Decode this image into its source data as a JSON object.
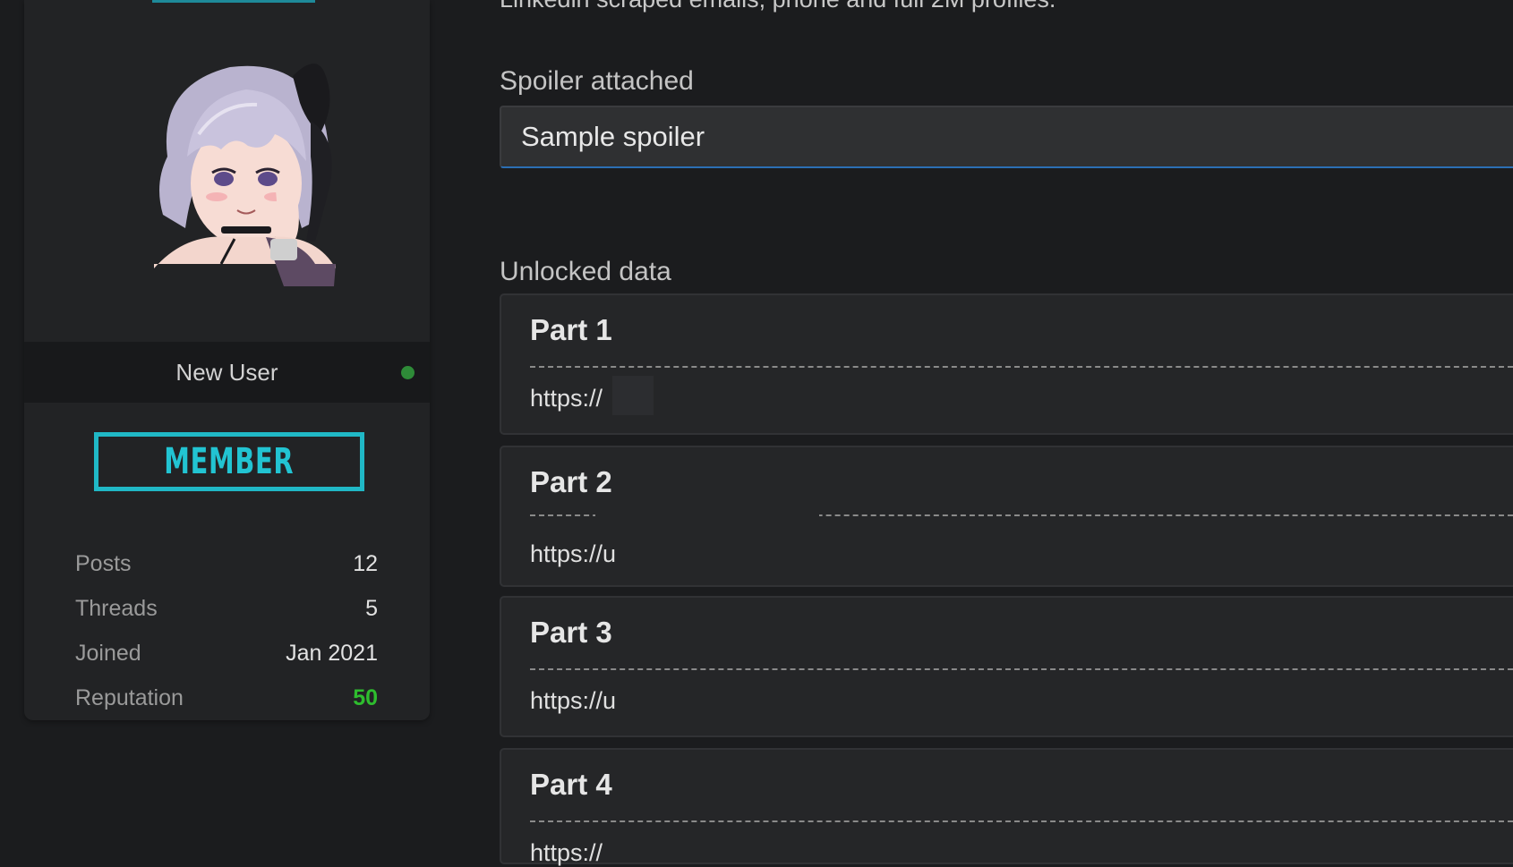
{
  "intro": {
    "text": "Linkedin scraped emails, phone and full 2M profiles."
  },
  "user": {
    "name": "New User",
    "rank": "MEMBER",
    "online_color": "#2e8b38",
    "stats": [
      {
        "label": "Posts",
        "value": "12"
      },
      {
        "label": "Threads",
        "value": "5"
      },
      {
        "label": "Joined",
        "value": "Jan 2021"
      },
      {
        "label": "Reputation",
        "value": "50"
      }
    ]
  },
  "spoiler": {
    "label": "Spoiler attached",
    "title": "Sample spoiler"
  },
  "unlocked": {
    "label": "Unlocked data",
    "parts": [
      {
        "title": "Part 1",
        "link": "https://"
      },
      {
        "title": "Part 2",
        "link": "https://u"
      },
      {
        "title": "Part 3",
        "link": "https://u"
      },
      {
        "title": "Part 4",
        "link": "https://"
      }
    ]
  },
  "colors": {
    "rank_accent": "#22c4d2",
    "reputation": "#2ebd2e",
    "spoiler_focus": "#2b6fb4"
  }
}
